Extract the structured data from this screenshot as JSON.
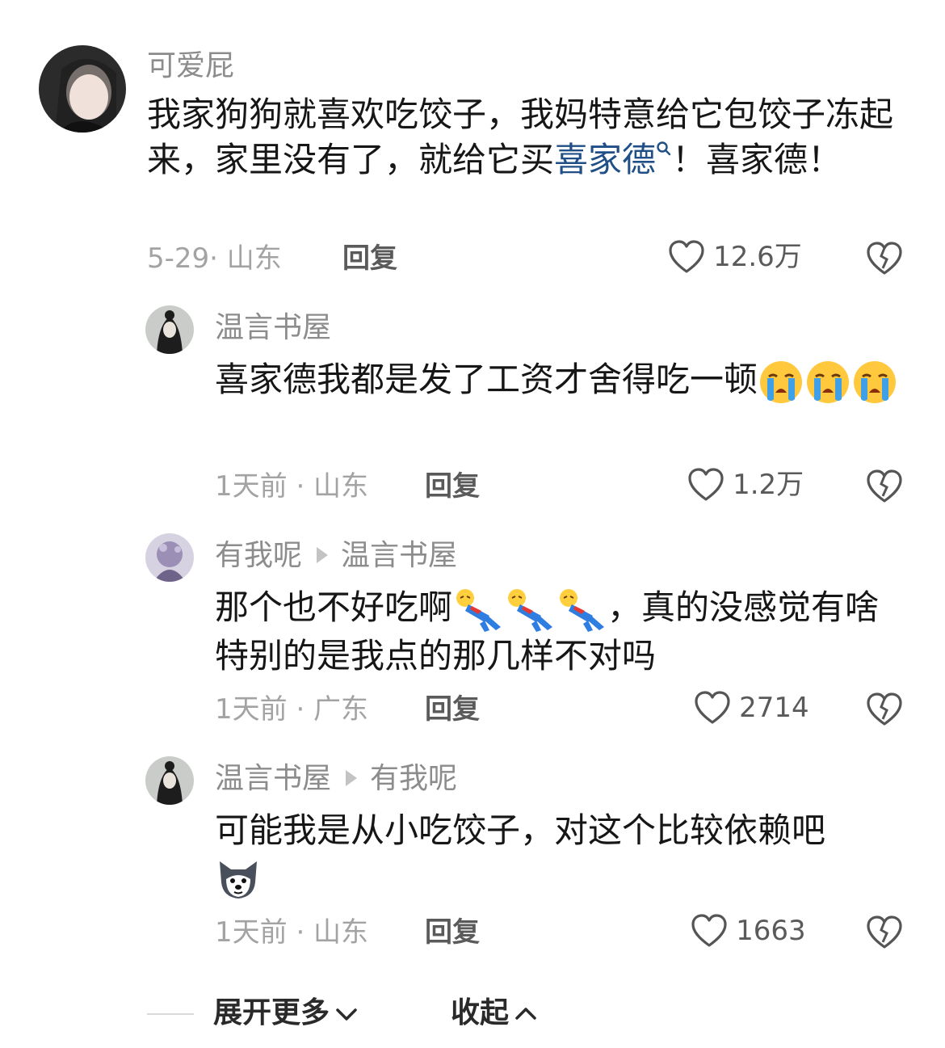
{
  "comments": [
    {
      "user": "可爱屁",
      "text_part1": "我家狗狗就喜欢吃饺子，我妈特意给它包饺子冻起来，家里没有了，就给它买",
      "link_text": "喜家德",
      "text_part2": "！喜家德！",
      "meta": "5-29· 山东",
      "reply_label": "回复",
      "likes": "12.6万"
    },
    {
      "user": "温言书屋",
      "text": "喜家德我都是发了工资才舍得吃一顿",
      "meta": "1天前 · 山东",
      "reply_label": "回复",
      "likes": "1.2万"
    },
    {
      "user": "有我呢",
      "reply_to": "温言书屋",
      "text_part1": "那个也不好吃啊",
      "text_part2": "，真的没感觉有啥特别的是我点的那几样不对吗",
      "meta": "1天前 · 广东",
      "reply_label": "回复",
      "likes": "2714"
    },
    {
      "user": "温言书屋",
      "reply_to": "有我呢",
      "text": "可能我是从小吃饺子，对这个比较依赖吧",
      "meta": "1天前 · 山东",
      "reply_label": "回复",
      "likes": "1663"
    }
  ],
  "footer": {
    "expand_label": "展开更多",
    "collapse_label": "收起"
  },
  "icons": {
    "like": "heart-outline-icon",
    "dislike": "broken-heart-icon",
    "search": "search-icon",
    "crying": "loudly-crying-face-emoji",
    "fall": "falling-person-emoji",
    "dog": "shiba-dog-emoji"
  }
}
